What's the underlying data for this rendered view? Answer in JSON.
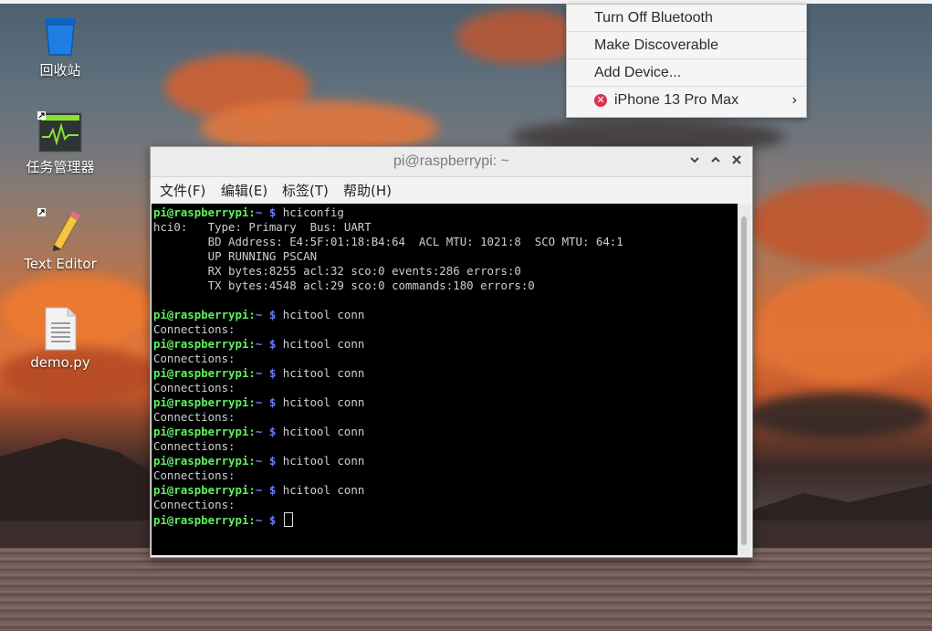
{
  "desktop": {
    "icons": [
      {
        "label": "回收站",
        "icon": "trash-icon"
      },
      {
        "label": "任务管理器",
        "icon": "task-manager-icon"
      },
      {
        "label": "Text Editor",
        "icon": "text-editor-icon"
      },
      {
        "label": "demo.py",
        "icon": "file-icon"
      }
    ]
  },
  "bluetooth_menu": {
    "items": [
      {
        "label": "Turn Off Bluetooth"
      },
      {
        "label": "Make Discoverable"
      },
      {
        "label": "Add Device..."
      },
      {
        "label": "iPhone 13 Pro Max",
        "status_icon": "disconnected-icon",
        "submenu": "chevron-right-icon"
      }
    ]
  },
  "terminal": {
    "title": "pi@raspberrypi: ~",
    "window_buttons": [
      "minimize",
      "maximize",
      "close"
    ],
    "menu": [
      "文件(F)",
      "编辑(E)",
      "标签(T)",
      "帮助(H)"
    ],
    "prompt_user": "pi@raspberrypi",
    "prompt_sep": ":",
    "prompt_path": "~ $",
    "lines": [
      {
        "type": "cmd",
        "text": " hciconfig"
      },
      {
        "type": "out",
        "text": "hci0:   Type: Primary  Bus: UART"
      },
      {
        "type": "out",
        "text": "        BD Address: E4:5F:01:18:B4:64  ACL MTU: 1021:8  SCO MTU: 64:1"
      },
      {
        "type": "out",
        "text": "        UP RUNNING PSCAN"
      },
      {
        "type": "out",
        "text": "        RX bytes:8255 acl:32 sco:0 events:286 errors:0"
      },
      {
        "type": "out",
        "text": "        TX bytes:4548 acl:29 sco:0 commands:180 errors:0"
      },
      {
        "type": "out",
        "text": ""
      },
      {
        "type": "cmd",
        "text": " hcitool conn"
      },
      {
        "type": "out",
        "text": "Connections:"
      },
      {
        "type": "cmd",
        "text": " hcitool conn"
      },
      {
        "type": "out",
        "text": "Connections:"
      },
      {
        "type": "cmd",
        "text": " hcitool conn"
      },
      {
        "type": "out",
        "text": "Connections:"
      },
      {
        "type": "cmd",
        "text": " hcitool conn"
      },
      {
        "type": "out",
        "text": "Connections:"
      },
      {
        "type": "cmd",
        "text": " hcitool conn"
      },
      {
        "type": "out",
        "text": "Connections:"
      },
      {
        "type": "cmd",
        "text": " hcitool conn"
      },
      {
        "type": "out",
        "text": "Connections:"
      },
      {
        "type": "cmd",
        "text": " hcitool conn"
      },
      {
        "type": "out",
        "text": "Connections:"
      },
      {
        "type": "cmd",
        "text": " ",
        "cursor": true
      }
    ]
  }
}
